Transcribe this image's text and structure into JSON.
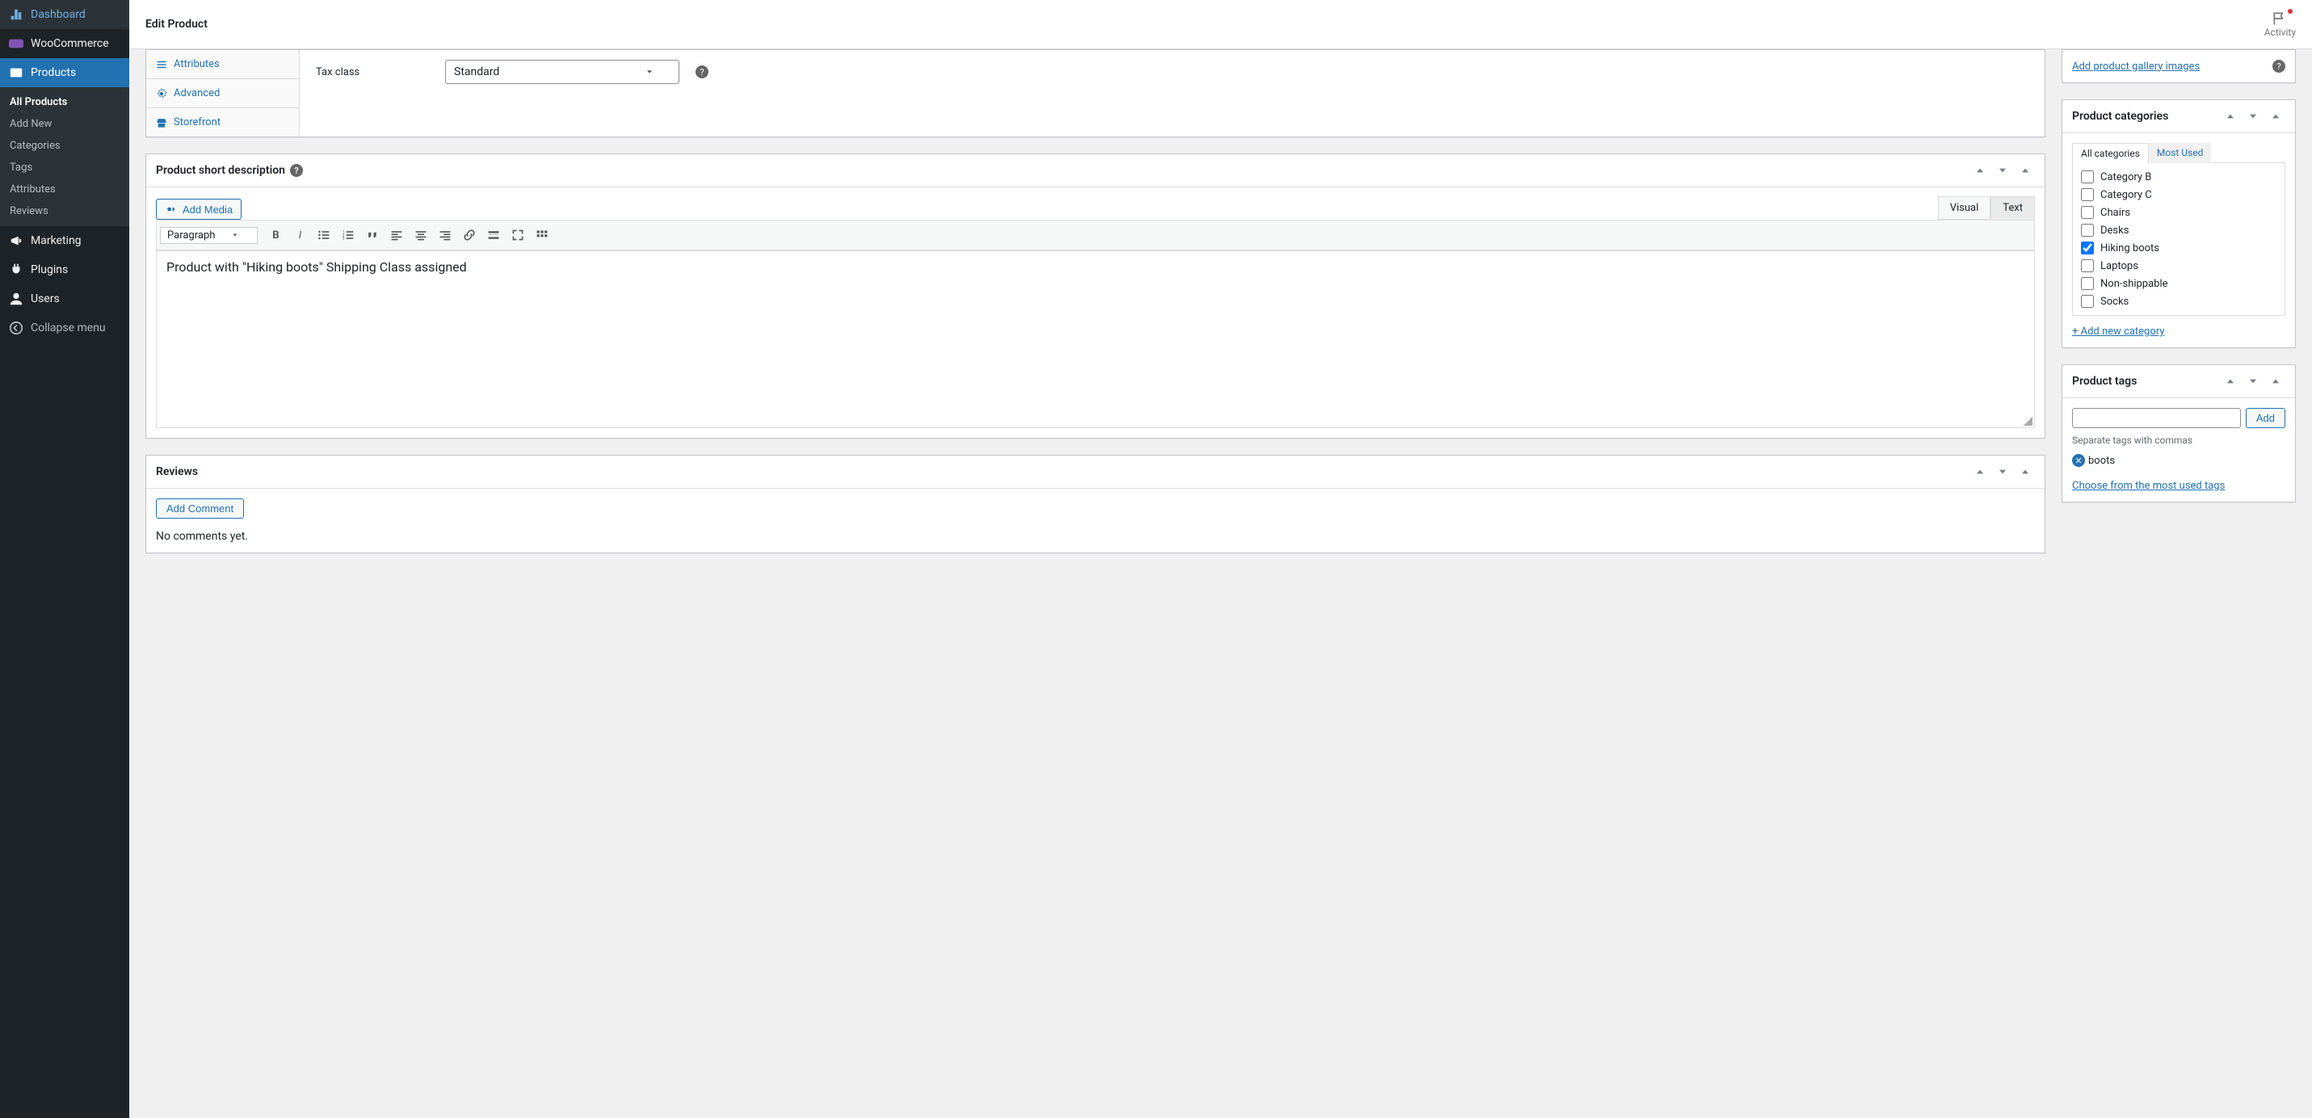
{
  "topbar": {
    "title": "Edit Product",
    "activity": "Activity"
  },
  "sidebar": {
    "items": [
      {
        "label": "Dashboard"
      },
      {
        "label": "WooCommerce"
      },
      {
        "label": "Products",
        "active": true
      },
      {
        "label": "Marketing"
      },
      {
        "label": "Plugins"
      },
      {
        "label": "Users"
      },
      {
        "label": "Collapse menu"
      }
    ],
    "submenu": [
      {
        "label": "All Products",
        "active": true
      },
      {
        "label": "Add New"
      },
      {
        "label": "Categories"
      },
      {
        "label": "Tags"
      },
      {
        "label": "Attributes"
      },
      {
        "label": "Reviews"
      }
    ]
  },
  "product_data": {
    "tabs": [
      {
        "label": "Attributes"
      },
      {
        "label": "Advanced"
      },
      {
        "label": "Storefront"
      }
    ],
    "tax_class_label": "Tax class",
    "tax_class_value": "Standard"
  },
  "short_desc": {
    "title": "Product short description",
    "add_media": "Add Media",
    "visual_tab": "Visual",
    "text_tab": "Text",
    "paragraph_label": "Paragraph",
    "content": "Product with \"Hiking boots\" Shipping Class assigned"
  },
  "reviews": {
    "title": "Reviews",
    "add_comment": "Add Comment",
    "empty": "No comments yet."
  },
  "gallery": {
    "add_link": "Add product gallery images"
  },
  "categories": {
    "title": "Product categories",
    "tab_all": "All categories",
    "tab_used": "Most Used",
    "items": [
      {
        "label": "Category B",
        "checked": false
      },
      {
        "label": "Category C",
        "checked": false
      },
      {
        "label": "Chairs",
        "checked": false
      },
      {
        "label": "Desks",
        "checked": false
      },
      {
        "label": "Hiking boots",
        "checked": true
      },
      {
        "label": "Laptops",
        "checked": false
      },
      {
        "label": "Non-shippable",
        "checked": false
      },
      {
        "label": "Socks",
        "checked": false
      }
    ],
    "add_new": "+ Add new category"
  },
  "tags": {
    "title": "Product tags",
    "add_btn": "Add",
    "hint": "Separate tags with commas",
    "tag1": "boots",
    "choose_link": "Choose from the most used tags"
  }
}
